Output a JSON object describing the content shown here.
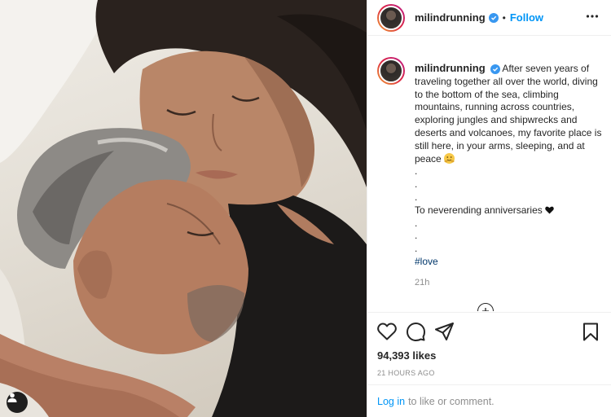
{
  "post": {
    "username": "milindrunning",
    "follow_label": "Follow",
    "caption_lines": [
      "After seven years of traveling together all over the world, diving to the bottom of the sea, climbing mountains, running across countries, exploring jungles and shipwrecks and deserts and volcanoes, my favorite place is still here, in your arms, sleeping, and at peace",
      ".",
      ".",
      ".",
      "To neverending anniversaries",
      ".",
      ".",
      "."
    ],
    "hashtag": "#love",
    "caption_time": "21h",
    "likes_count": "94,393",
    "likes_label": "likes",
    "post_time": "21 HOURS AGO",
    "login_link": "Log in",
    "login_suffix": "to like or comment."
  },
  "icons": {
    "verified": "verified-badge-icon",
    "more": "more-options-icon",
    "like": "heart-icon",
    "comment": "comment-bubble-icon",
    "share": "paper-plane-icon",
    "save": "bookmark-icon",
    "user_tag": "user-tag-icon",
    "load_more": "plus-circle-icon",
    "heart_emoji": "black-heart-emoji",
    "hug_emoji": "hugging-face-emoji"
  },
  "colors": {
    "accent": "#0095f6",
    "hashtag": "#00376b",
    "verified": "#3897f0",
    "muted": "#8e8e8e"
  }
}
